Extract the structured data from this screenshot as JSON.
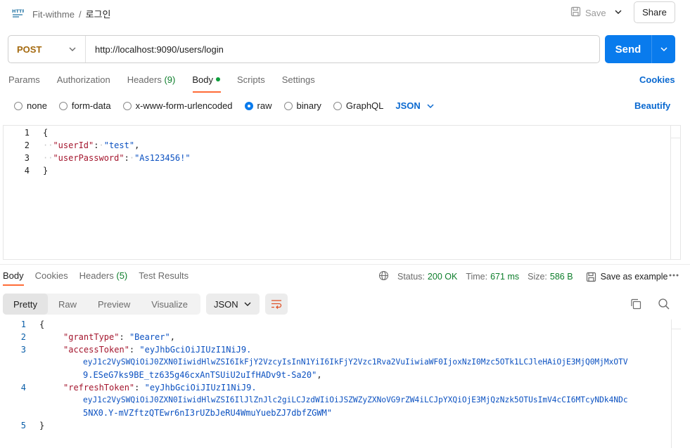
{
  "header": {
    "collection": "Fit-withme",
    "separator": "/",
    "request_name": "로그인",
    "save_label": "Save",
    "share_label": "Share"
  },
  "request": {
    "method": "POST",
    "url": "http://localhost:9090/users/login",
    "send_label": "Send"
  },
  "request_tabs": {
    "params": "Params",
    "authorization": "Authorization",
    "headers": "Headers",
    "headers_count": "(9)",
    "body": "Body",
    "scripts": "Scripts",
    "settings": "Settings",
    "cookies": "Cookies"
  },
  "body_types": {
    "none": "none",
    "form_data": "form-data",
    "urlencoded": "x-www-form-urlencoded",
    "raw": "raw",
    "binary": "binary",
    "graphql": "GraphQL",
    "format": "JSON",
    "beautify": "Beautify"
  },
  "request_body": {
    "ln1": "1",
    "ln2": "2",
    "ln3": "3",
    "ln4": "4",
    "open": "{",
    "k1": "\"userId\"",
    "v1": "\"test\"",
    "k2": "\"userPassword\"",
    "v2": "\"As123456!\"",
    "close": "}"
  },
  "response_tabs": {
    "body": "Body",
    "cookies": "Cookies",
    "headers": "Headers",
    "headers_count": "(5)",
    "test_results": "Test Results"
  },
  "response_status": {
    "status_label": "Status:",
    "status_value": "200 OK",
    "time_label": "Time:",
    "time_value": "671 ms",
    "size_label": "Size:",
    "size_value": "586 B",
    "save_example": "Save as example"
  },
  "response_view": {
    "pretty": "Pretty",
    "raw": "Raw",
    "preview": "Preview",
    "visualize": "Visualize",
    "format": "JSON"
  },
  "response_body": {
    "ln1": "1",
    "ln2": "2",
    "ln3": "3",
    "ln4": "4",
    "ln5": "5",
    "open": "{",
    "k1": "\"grantType\"",
    "v1": "\"Bearer\"",
    "k2": "\"accessToken\"",
    "v2a": "\"eyJhbGciOiJIUzI1NiJ9.",
    "v2b": "eyJ1c2VySWQiOiJ0ZXN0IiwidHlwZSI6IkFjY2VzcyIsInN1YiI6IkFjY2Vzc1Rva2VuIiwiaWF0IjoxNzI0Mzc5OTk1LCJleHAiOjE3MjQ0MjMxOTV",
    "v2c": "9.ESeG7ks9BE_tz635g46cxAnTSUiU2uIfHADv9t-Sa20\"",
    "k3": "\"refreshToken\"",
    "v3a": "\"eyJhbGciOiJIUzI1NiJ9.",
    "v3b": "eyJ1c2VySWQiOiJ0ZXN0IiwidHlwZSI6IlJlZnJlc2giLCJzdWIiOiJSZWZyZXNoVG9rZW4iLCJpYXQiOjE3MjQzNzk5OTUsImV4cCI6MTcyNDk4NDc",
    "v3c": "5NX0.Y-mVZftzQTEwr6nI3rUZbJeRU4WmuYuebZJ7dbfZGWM\"",
    "close": "}"
  },
  "icons": {
    "http": "http-file-icon",
    "save": "save-icon",
    "chevron": "chevron-down-icon",
    "globe": "globe-icon",
    "copy": "copy-icon",
    "search": "search-icon",
    "wrap": "wrap-lines-icon",
    "more": "more-horizontal-icon"
  },
  "colors": {
    "accent": "#097bed",
    "method": "#a4690e",
    "status_ok": "#0d7e2b",
    "active_tab_underline": "#ff6c37",
    "json_key": "#a4162e",
    "json_string": "#0b51c1"
  }
}
